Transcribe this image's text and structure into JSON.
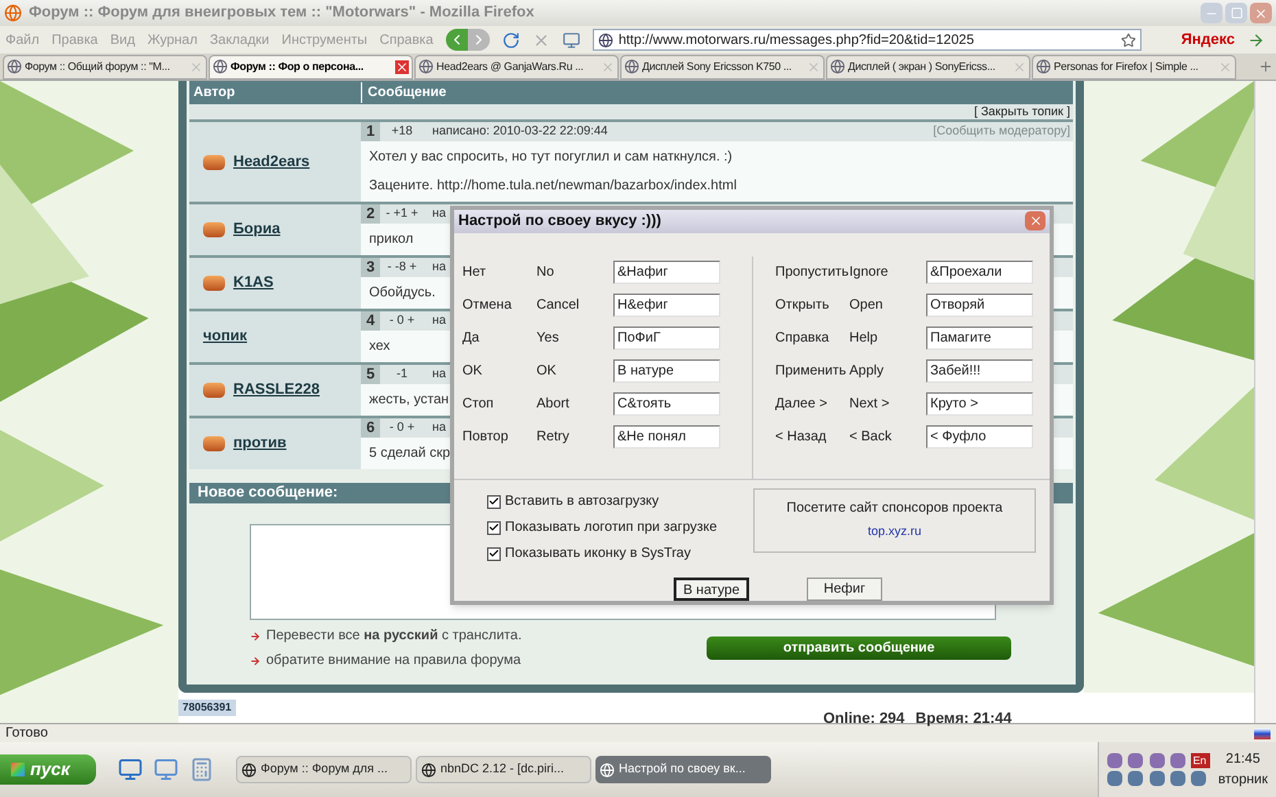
{
  "browser": {
    "title": "Форум :: Форум для внеигровых тем :: \"Motorwars\" - Mozilla Firefox",
    "menu": [
      "Файл",
      "Правка",
      "Вид",
      "Журнал",
      "Закладки",
      "Инструменты",
      "Справка"
    ],
    "url": "http://www.motorwars.ru/messages.php?fid=20&tid=12025",
    "search_engine": "Яндекс",
    "tabs": [
      {
        "label": "Форум :: Общий форум :: \"M...",
        "selected": false
      },
      {
        "label": "Форум :: Фор о персона...",
        "selected": true
      },
      {
        "label": "Head2ears @ GanjaWars.Ru ...",
        "selected": false
      },
      {
        "label": "Дисплей Sony Ericsson K750 ...",
        "selected": false
      },
      {
        "label": "Дисплей ( экран ) SonyEricss...",
        "selected": false
      },
      {
        "label": "Personas for Firefox | Simple ...",
        "selected": false
      }
    ],
    "status": "Готово"
  },
  "forum": {
    "columns": [
      "Автор",
      "Сообщение"
    ],
    "close_topic": "[ Закрыть топик ]",
    "posts": [
      {
        "number": "1",
        "rating": "+18",
        "author": "Head2ears",
        "avatar": true,
        "meta": "написано: 2010-03-22 22:09:44",
        "report": "[Сообщить модератору]",
        "lines": [
          "Хотел у вас спросить, но тут погуглил и сам наткнулся. :)",
          "Зацените. http://home.tula.net/newman/bazarbox/index.html"
        ]
      },
      {
        "number": "2",
        "rating": "- +1 +",
        "author": "Бориа",
        "avatar": true,
        "meta": "на",
        "lines": [
          "прикол"
        ]
      },
      {
        "number": "3",
        "rating": "- -8 +",
        "author": "K1AS",
        "avatar": true,
        "meta": "на",
        "lines": [
          "Обойдусь."
        ]
      },
      {
        "number": "4",
        "rating": "- 0 +",
        "author": "чопик",
        "avatar": false,
        "meta": "на",
        "lines": [
          "хех"
        ]
      },
      {
        "number": "5",
        "rating": "-1",
        "author": "RASSLE228",
        "avatar": true,
        "meta": "на",
        "lines": [
          "жесть, устан"
        ]
      },
      {
        "number": "6",
        "rating": "- 0 +",
        "author": "против",
        "avatar": true,
        "meta": "на",
        "lines": [
          "5 сделай скр"
        ]
      }
    ],
    "new_message": {
      "title": "Новое сообщение:",
      "hints": [
        "Перевести все **на русский** с транслита.",
        "обратите внимание на правила форума"
      ],
      "send": "отправить сообщение"
    },
    "footer": {
      "counter": "78056391",
      "online": "Online: 294",
      "time": "Время: 21:44"
    }
  },
  "dialog": {
    "title": "Настрой по своеу вкусу :)))",
    "left": [
      {
        "ru": "Нет",
        "en": "No",
        "value": "&Нафиг"
      },
      {
        "ru": "Отмена",
        "en": "Cancel",
        "value": "Н&ефиг"
      },
      {
        "ru": "Да",
        "en": "Yes",
        "value": "ПоФиГ"
      },
      {
        "ru": "OK",
        "en": "OK",
        "value": "В натуре"
      },
      {
        "ru": "Стоп",
        "en": "Abort",
        "value": "С&тоять"
      },
      {
        "ru": "Повтор",
        "en": "Retry",
        "value": "&Не понял"
      }
    ],
    "right": [
      {
        "ru": "Пропустить",
        "en": "Ignore",
        "value": "&Проехали"
      },
      {
        "ru": "Открыть",
        "en": "Open",
        "value": "Отворяй"
      },
      {
        "ru": "Справка",
        "en": "Help",
        "value": "Памагите"
      },
      {
        "ru": "Применить",
        "en": "Apply",
        "value": "Забей!!!"
      },
      {
        "ru": "Далее >",
        "en": "Next >",
        "value": "Круто >"
      },
      {
        "ru": "< Назад",
        "en": "< Back",
        "value": "< Фуфло"
      }
    ],
    "checkboxes": [
      {
        "label": "Вставить в автозагрузку",
        "checked": true
      },
      {
        "label": "Показывать логотип при загрузке",
        "checked": true
      },
      {
        "label": "Показывать иконку в SysTray",
        "checked": true
      }
    ],
    "sponsor": {
      "text": "Посетите сайт спонсоров проекта",
      "link": "top.xyz.ru"
    },
    "buttons": [
      {
        "label": "В натуре",
        "default": true
      },
      {
        "label": "Нефиг",
        "default": false
      }
    ]
  },
  "taskbar": {
    "start": "пуск",
    "tasks": [
      {
        "label": "Форум :: Форум для ...",
        "selected": false
      },
      {
        "label": "nbnDC 2.12 - [dc.piri...",
        "selected": false
      },
      {
        "label": "Настрой по своеу вк...",
        "selected": true
      }
    ],
    "language": "En",
    "clock": "21:45",
    "day": "вторник"
  }
}
